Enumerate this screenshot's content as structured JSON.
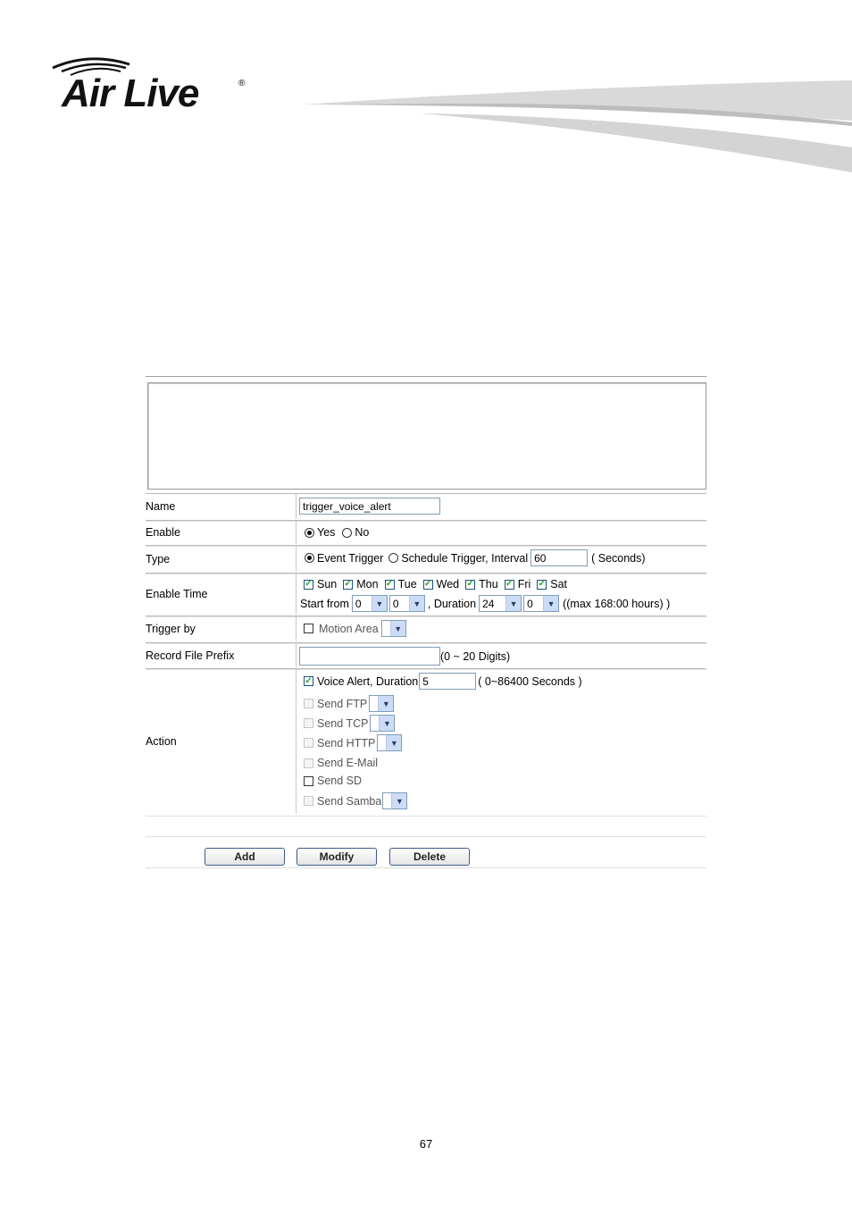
{
  "logo": {
    "text": "Air Live",
    "mark": "®"
  },
  "form": {
    "name": {
      "label": "Name",
      "value": "trigger_voice_alert"
    },
    "enable": {
      "label": "Enable",
      "yes": "Yes",
      "no": "No",
      "selected": "Yes"
    },
    "type": {
      "label": "Type",
      "event": "Event Trigger",
      "schedule": "Schedule Trigger, Interval",
      "interval": "60",
      "unit": "( Seconds)",
      "selected": "Event Trigger"
    },
    "enable_time": {
      "label": "Enable Time",
      "days": [
        "Sun",
        "Mon",
        "Tue",
        "Wed",
        "Thu",
        "Fri",
        "Sat"
      ],
      "start_label": "Start from",
      "start_hour": "0",
      "start_min": "0",
      "duration_label": ", Duration",
      "duration_hour": "24",
      "duration_min": "0",
      "max_note": "((max 168:00 hours) )"
    },
    "trigger_by": {
      "label": "Trigger by",
      "option": "Motion Area"
    },
    "record_prefix": {
      "label": "Record File Prefix",
      "value": "",
      "hint": "(0 ~ 20 Digits)"
    },
    "action": {
      "label": "Action",
      "voice_alert": "Voice Alert, Duration",
      "voice_duration": "5",
      "voice_hint": "( 0~86400 Seconds )",
      "send_ftp": "Send FTP",
      "send_tcp": "Send TCP",
      "send_http": "Send HTTP",
      "send_email": "Send E-Mail",
      "send_sd": "Send SD",
      "send_samba": "Send Samba"
    }
  },
  "buttons": {
    "add": "Add",
    "modify": "Modify",
    "delete": "Delete"
  },
  "page_number": "67",
  "colors": {
    "swoosh": "#d9d9d9",
    "checkmark": "#21a121",
    "field_border": "#7f9db9"
  }
}
